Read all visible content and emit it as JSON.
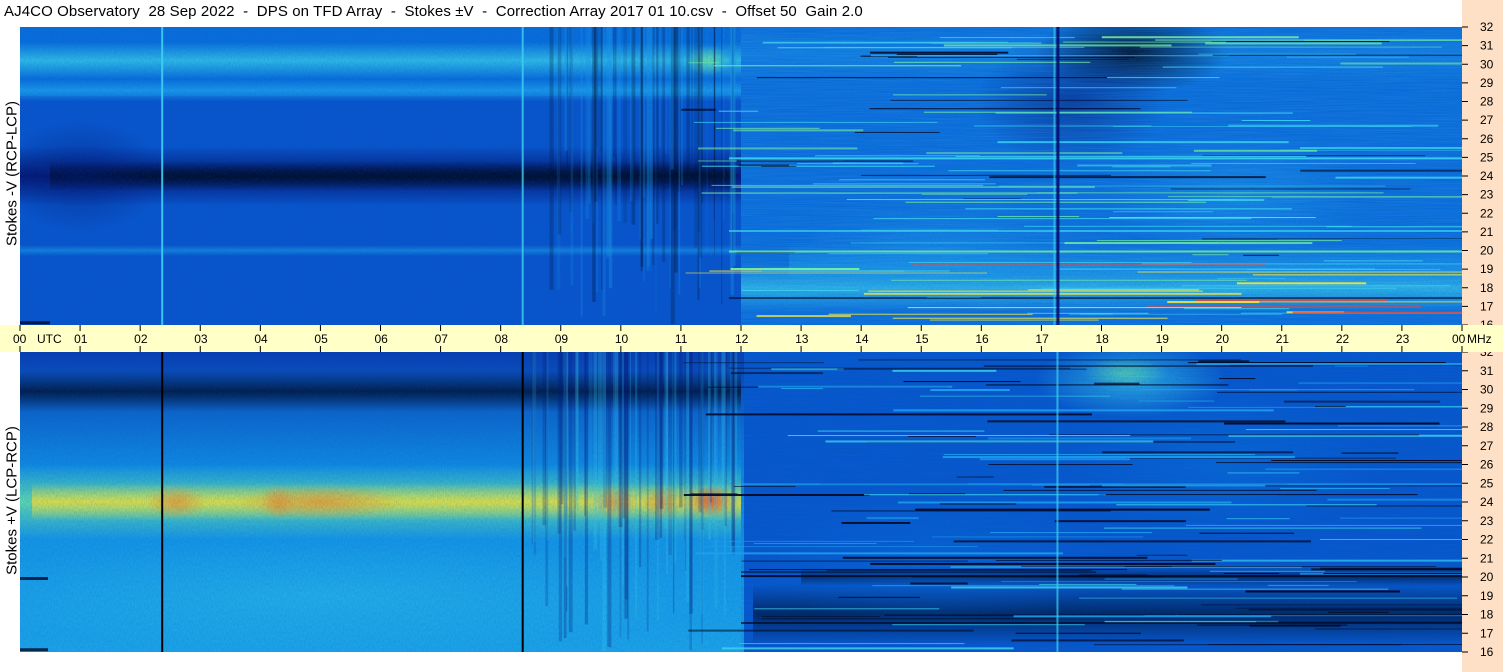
{
  "title": "AJ4CO Observatory  28 Sep 2022  -  DPS on TFD Array  -  Stokes ±V  -  Correction Array 2017 01 10.csv  -  Offset 50  Gain 2.0",
  "panels": [
    {
      "ylabel": "Stokes -V (RCP-LCP)",
      "name": "top-spectrogram"
    },
    {
      "ylabel": "Stokes +V (LCP-RCP)",
      "name": "bottom-spectrogram"
    }
  ],
  "time_axis": {
    "labels": [
      "00",
      "01",
      "02",
      "03",
      "04",
      "05",
      "06",
      "07",
      "08",
      "09",
      "10",
      "11",
      "12",
      "13",
      "14",
      "15",
      "16",
      "17",
      "18",
      "19",
      "20",
      "21",
      "22",
      "23",
      "00"
    ],
    "first_unit": "UTC",
    "last_unit": "MHz"
  },
  "freq_axis": {
    "labels": [
      "32",
      "31",
      "30",
      "29",
      "28",
      "27",
      "26",
      "25",
      "24",
      "23",
      "22",
      "21",
      "20",
      "19",
      "18",
      "17",
      "16"
    ]
  },
  "colors": {
    "deep": "#000a28",
    "dark": "#05106e",
    "mid": "#0a46c8",
    "base": "#0a78e6",
    "light": "#1ea0f0",
    "cyan": "#3cd2f0",
    "green": "#78f0a0",
    "yellow": "#f0e640",
    "orange": "#f09030",
    "red": "#f04830",
    "axis_bg": "#ffffc8",
    "right_bg": "#fde0c6"
  },
  "chart_data": {
    "type": "heatmap",
    "title": "AJ4CO Observatory  28 Sep 2022  -  DPS on TFD Array  -  Stokes ±V  -  Correction Array 2017 01 10.csv  -  Offset 50  Gain 2.0",
    "x": {
      "label": "UTC",
      "range": [
        0,
        24
      ],
      "ticks": [
        0,
        1,
        2,
        3,
        4,
        5,
        6,
        7,
        8,
        9,
        10,
        11,
        12,
        13,
        14,
        15,
        16,
        17,
        18,
        19,
        20,
        21,
        22,
        23,
        24
      ]
    },
    "y": {
      "label": "MHz",
      "range": [
        16,
        32
      ],
      "ticks": [
        16,
        17,
        18,
        19,
        20,
        21,
        22,
        23,
        24,
        25,
        26,
        27,
        28,
        29,
        30,
        31,
        32
      ]
    },
    "series": [
      {
        "name": "Stokes -V (RCP-LCP)",
        "features": [
          {
            "band_mhz": 24,
            "t_start": 0,
            "t_end": 12,
            "level": "deep"
          },
          {
            "band_mhz": 30,
            "t_start": 17.5,
            "t_end": 19.2,
            "level": "deep"
          },
          {
            "band_mhz": 29.5,
            "t_start": 0,
            "t_end": 12,
            "level": "cyan"
          },
          {
            "band_mhz": 18,
            "t_start": 12,
            "t_end": 24,
            "level": "yellow"
          }
        ]
      },
      {
        "name": "Stokes +V (LCP-RCP)",
        "features": [
          {
            "band_mhz": 24,
            "t_start": 0,
            "t_end": 12,
            "level": "yellow"
          },
          {
            "band_mhz": 24,
            "t_start": 11.3,
            "t_end": 11.9,
            "level": "orange"
          },
          {
            "band_mhz": 30,
            "t_start": 0,
            "t_end": 12,
            "level": "dark"
          },
          {
            "band_mhz": 30,
            "t_start": 17.5,
            "t_end": 19.2,
            "level": "cyan"
          },
          {
            "band_mhz": 18,
            "t_start": 12,
            "t_end": 24,
            "level": "dark"
          }
        ]
      }
    ],
    "vertical_lines_utc": [
      2.35,
      8.35,
      17.25
    ]
  }
}
